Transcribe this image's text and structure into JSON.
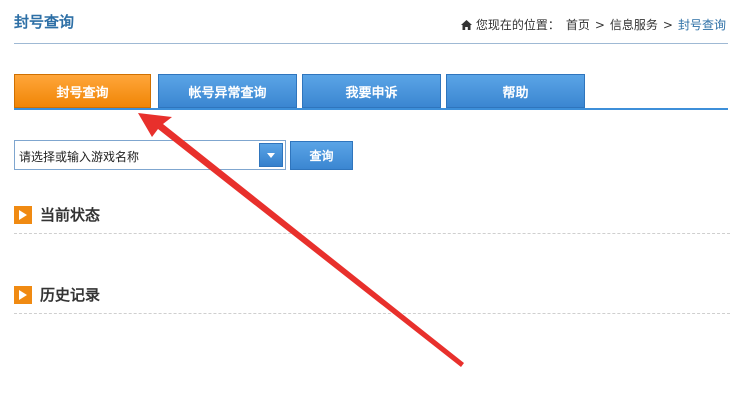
{
  "page": {
    "title": "封号查询"
  },
  "breadcrumb": {
    "prefix": "您现在的位置：",
    "items": [
      "首页",
      "信息服务",
      "封号查询"
    ],
    "separator": ">"
  },
  "tabs": [
    {
      "label": "封号查询",
      "active": true
    },
    {
      "label": "帐号异常查询",
      "active": false
    },
    {
      "label": "我要申诉",
      "active": false
    },
    {
      "label": "帮助",
      "active": false
    }
  ],
  "search": {
    "select_value": "请选择或输入游戏名称",
    "button_label": "查询"
  },
  "sections": {
    "current_status": "当前状态",
    "history": "历史记录"
  },
  "colors": {
    "accent_blue": "#3b86d1",
    "active_orange": "#f08506",
    "annotation_red": "#e8302c"
  }
}
